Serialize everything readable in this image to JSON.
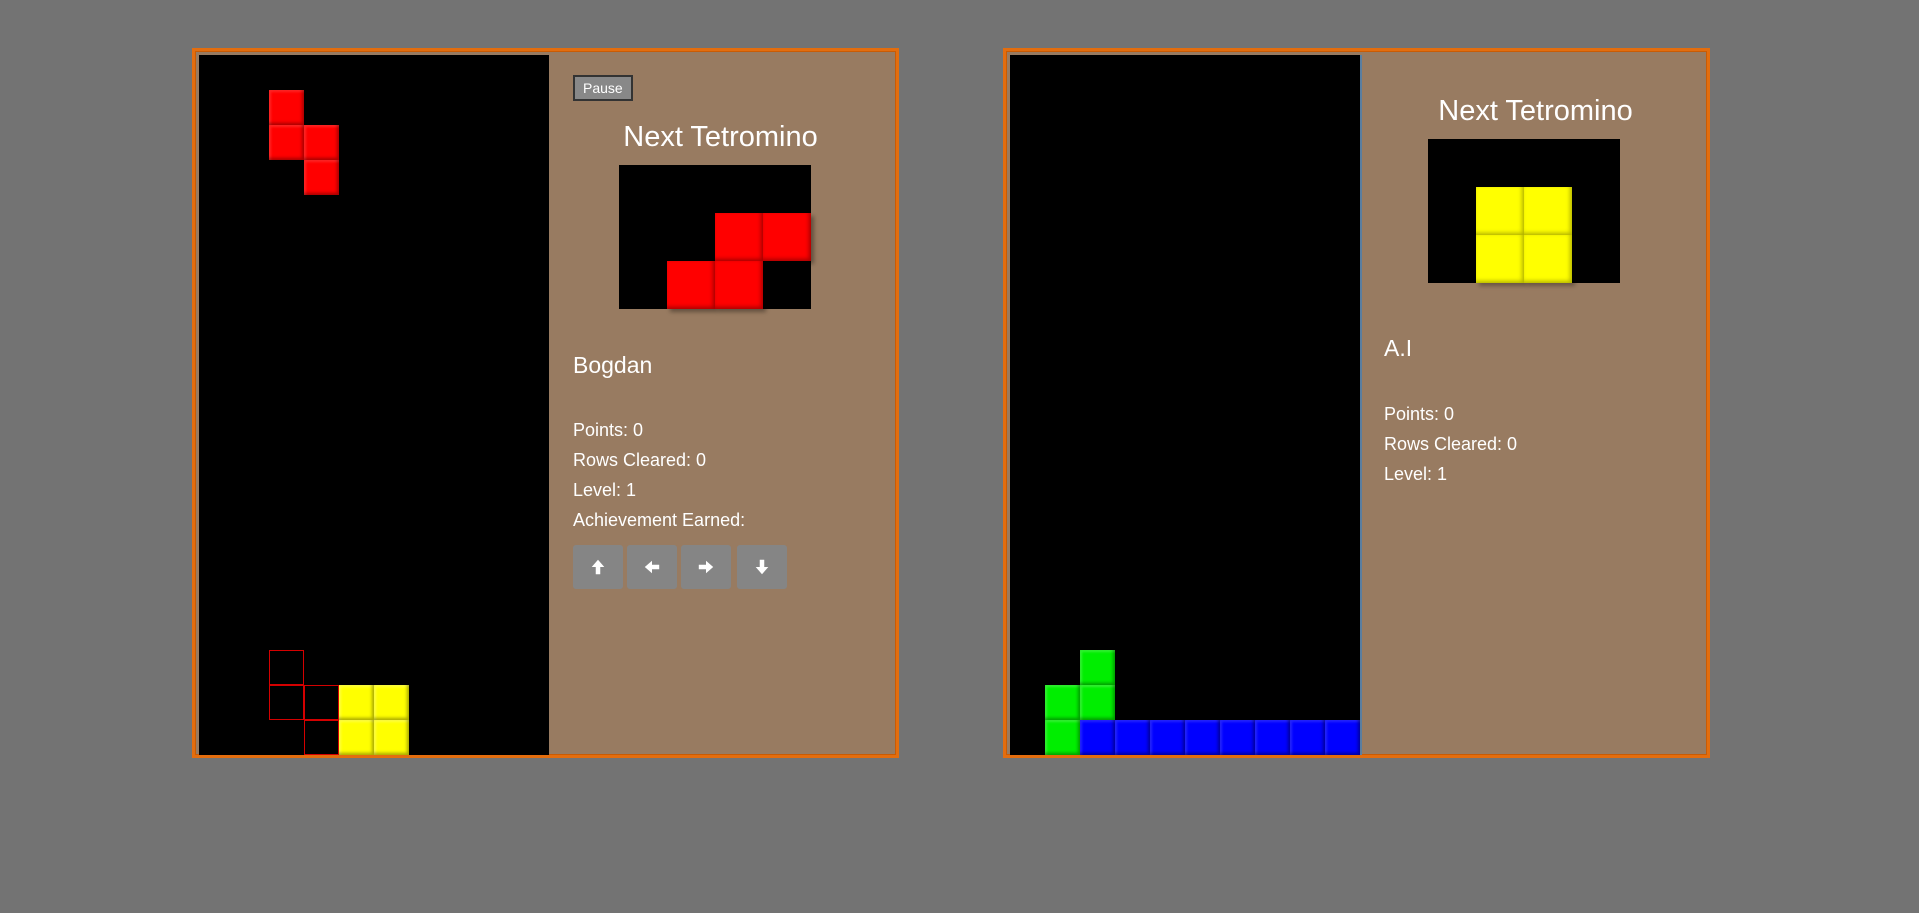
{
  "player": {
    "pause_label": "Pause",
    "next_title": "Next Tetromino",
    "name": "Bogdan",
    "points": "Points: 0",
    "rows_cleared": "Rows Cleared: 0",
    "level": "Level: 1",
    "achievement": "Achievement Earned:",
    "controls": [
      "arrow-up-icon",
      "arrow-left-icon",
      "arrow-right-icon",
      "arrow-down-icon"
    ],
    "falling_piece": {
      "type": "S",
      "color": "#ff0000"
    },
    "next_piece": {
      "type": "S",
      "color": "#ff0000"
    }
  },
  "ai": {
    "next_title": "Next Tetromino",
    "name": "A.I",
    "points": "Points: 0",
    "rows_cleared": "Rows Cleared: 0",
    "level": "Level: 1",
    "next_piece": {
      "type": "O",
      "color": "#ffff00"
    }
  },
  "colors": {
    "background": "#737373",
    "frame": "#e36d0e",
    "panel": "#987b61",
    "red": "#ff0000",
    "yellow": "#ffff00",
    "green": "#00ee00",
    "blue": "#0000ff"
  }
}
